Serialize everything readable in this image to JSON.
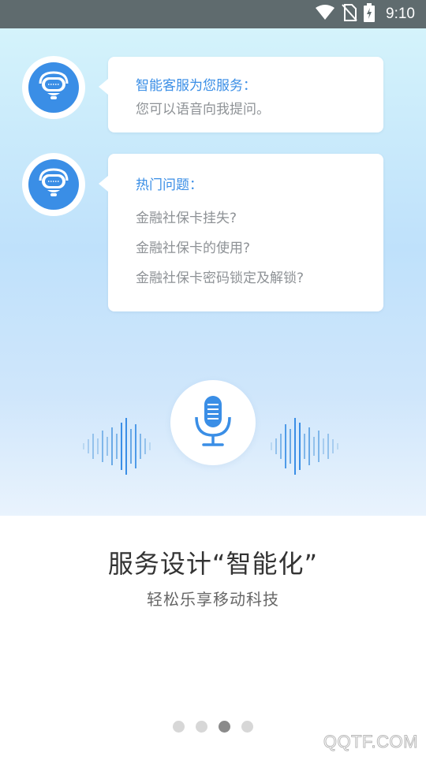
{
  "status_bar": {
    "time": "9:10",
    "icons": [
      "wifi-icon",
      "no-sim-icon",
      "battery-charging-icon"
    ]
  },
  "chat": [
    {
      "avatar_icon": "robot-assistant-icon",
      "title": "智能客服为您服务：",
      "lines": [
        "您可以语音向我提问。"
      ]
    },
    {
      "avatar_icon": "robot-assistant-icon",
      "title": "热门问题：",
      "lines": [
        "金融社保卡挂失?",
        "金融社保卡的使用?",
        "金融社保卡密码锁定及解锁?"
      ]
    }
  ],
  "voice": {
    "icon": "microphone-icon"
  },
  "headline": "服务设计“智能化”",
  "subline": "轻松乐享移动科技",
  "pager": {
    "total": 4,
    "current": 3
  },
  "watermark": "QQTF.COM",
  "colors": {
    "accent": "#3a8ee6",
    "status_bar": "#5f6b6e",
    "dot_inactive": "#d7d7d7",
    "dot_active": "#8a8a8a"
  }
}
